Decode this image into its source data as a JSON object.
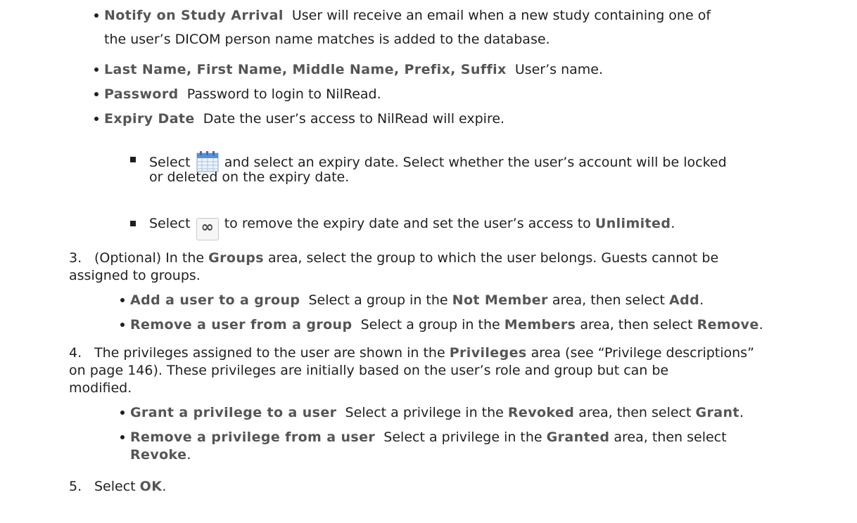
{
  "items": {
    "notify": {
      "term": "Notify on Study Arrival",
      "desc_line1": "User will receive an email when a new study containing one of",
      "desc_line2": "the user’s DICOM person name matches is added to the database."
    },
    "names": {
      "term": "Last Name, First Name, Middle Name, Prefix, Suffix",
      "desc": "User’s name."
    },
    "password": {
      "term": "Password",
      "desc": "Password to login to NilRead."
    },
    "expiry": {
      "term": "Expiry Date",
      "desc": "Date the user’s access to NilRead will expire.",
      "sub1": {
        "pre": "Select",
        "post_line1": "and select an expiry date. Select whether the user’s account will be locked",
        "line2": "or deleted on the expiry date."
      },
      "sub2": {
        "pre": "Select",
        "mid": "to remove the expiry date and set the user’s access to",
        "bold": "Unlimited",
        "end": "."
      }
    }
  },
  "step3": {
    "number": "3.",
    "l1_a": "(Optional) In the",
    "l1_b": "Groups",
    "l1_c": "area, select the group to which the user belongs. Guests cannot be",
    "l2": "assigned to groups.",
    "add": {
      "term": "Add a user to a group",
      "a": "Select a group in the",
      "b": "Not Member",
      "c": "area, then select",
      "d": "Add",
      "e": "."
    },
    "remove": {
      "term": "Remove a user from a group",
      "a": "Select a group in the",
      "b": "Members",
      "c": "area, then select",
      "d": "Remove",
      "e": "."
    }
  },
  "step4": {
    "number": "4.",
    "l1_a": "The privileges assigned to the user are shown in the",
    "l1_b": "Privileges",
    "l1_c": "area (see “Privilege descriptions”",
    "l2": "on page 146). These privileges are initially based on the user’s role and group but can be",
    "l3": "modified.",
    "grant": {
      "term": "Grant a privilege to a user",
      "a": "Select a privilege in the",
      "b": "Revoked",
      "c": "area, then select",
      "d": "Grant",
      "e": "."
    },
    "revoke": {
      "term": "Remove a privilege from a user",
      "a": "Select a privilege in the",
      "b": "Granted",
      "c": "area, then select",
      "d": "Revoke",
      "e": "."
    }
  },
  "step5": {
    "number": "5.",
    "a": "Select",
    "b": "OK",
    "c": "."
  },
  "icons": {
    "calendar": "calendar-icon",
    "infinity": "infinity-icon",
    "infinity_glyph": "∞"
  }
}
